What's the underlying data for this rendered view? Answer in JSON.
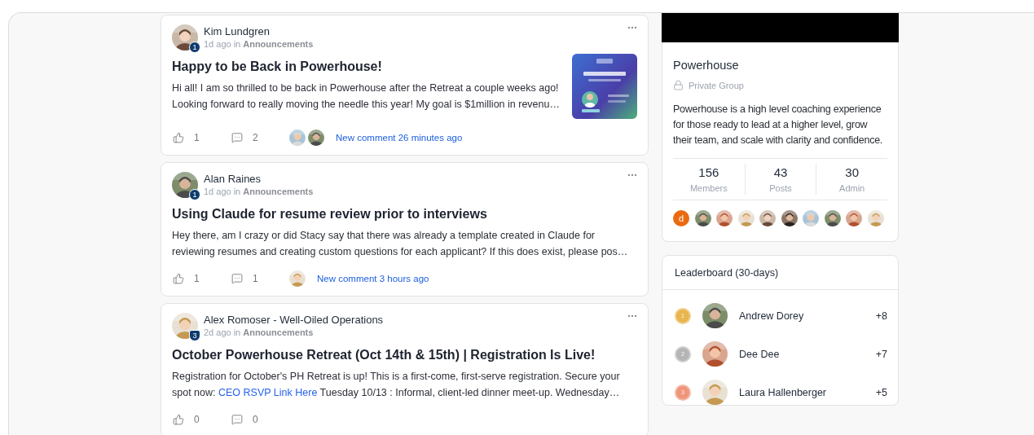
{
  "posts": [
    {
      "author": "Kim Lundgren",
      "badge": {
        "kind": "circle",
        "label": "1"
      },
      "time": "1d ago",
      "in_word": "in",
      "category": "Announcements",
      "title": "Happy to be Back in Powerhouse!",
      "excerpt": [
        {
          "kind": "text",
          "text": "Hi all! I am so thrilled to be back in Powerhouse after the Retreat a couple weeks ago! Looking forward to really moving the needle this year! My goal is $1million in revenu…"
        }
      ],
      "thumbnail": {
        "kind": "picture"
      },
      "likes": "1",
      "comments": "2",
      "commenters": [
        {
          "kind": "picture"
        },
        {
          "kind": "picture"
        }
      ],
      "new_comment": "New comment 26 minutes ago"
    },
    {
      "author": "Alan Raines",
      "badge": {
        "kind": "circle",
        "label": "1"
      },
      "time": "1d ago",
      "in_word": "in",
      "category": "Announcements",
      "title": "Using Claude for resume review prior to interviews",
      "excerpt": [
        {
          "kind": "text",
          "text": "Hey there, am I crazy or did Stacy say that there was already a template created in Claude for reviewing resumes and creating custom questions for each applicant? If this does exist, please pos…"
        }
      ],
      "likes": "1",
      "comments": "1",
      "commenters": [
        {
          "kind": "picture"
        }
      ],
      "new_comment": "New comment 3 hours ago"
    },
    {
      "author": "Alex Romoser - Well-Oiled Operations",
      "badge": {
        "kind": "shield",
        "label": "3"
      },
      "time": "2d ago",
      "in_word": "in",
      "category": "Announcements",
      "title": "October Powerhouse Retreat (Oct 14th & 15th) | Registration Is Live!",
      "excerpt": [
        {
          "kind": "text",
          "text": "Registration for October's PH Retreat is up! This is a first-come, first-serve registration. Secure your spot now: "
        },
        {
          "kind": "link",
          "text": "CEO RSVP Link Here"
        },
        {
          "kind": "text",
          "text": " Tuesday 10/13 : Informal, client-led dinner meet-up. Wednesday…"
        }
      ],
      "likes": "0",
      "comments": "0"
    }
  ],
  "group": {
    "name": "Powerhouse",
    "privacy": "Private Group",
    "description": "Powerhouse is a high level coaching experience for those ready to lead at a higher level, grow their team, and scale with clarity and confidence.",
    "stats": [
      {
        "value": "156",
        "label": "Members"
      },
      {
        "value": "43",
        "label": "Posts"
      },
      {
        "value": "30",
        "label": "Admin"
      }
    ],
    "members": [
      {
        "kind": "letter",
        "letter": "d",
        "color": "#ea6a12"
      },
      {
        "kind": "picture"
      },
      {
        "kind": "picture"
      },
      {
        "kind": "picture"
      },
      {
        "kind": "picture"
      },
      {
        "kind": "picture"
      },
      {
        "kind": "picture"
      },
      {
        "kind": "picture"
      },
      {
        "kind": "picture"
      },
      {
        "kind": "picture"
      }
    ]
  },
  "leaderboard": {
    "title": "Leaderboard (30-days)",
    "entries": [
      {
        "rank": "1",
        "color": "#e9b54f",
        "name": "Andrew Dorey",
        "points": "+8"
      },
      {
        "rank": "2",
        "color": "#b5b5b5",
        "name": "Dee Dee",
        "points": "+7"
      },
      {
        "rank": "3",
        "color": "#f0957a",
        "name": "Laura Hallenberger",
        "points": "+5"
      }
    ]
  }
}
